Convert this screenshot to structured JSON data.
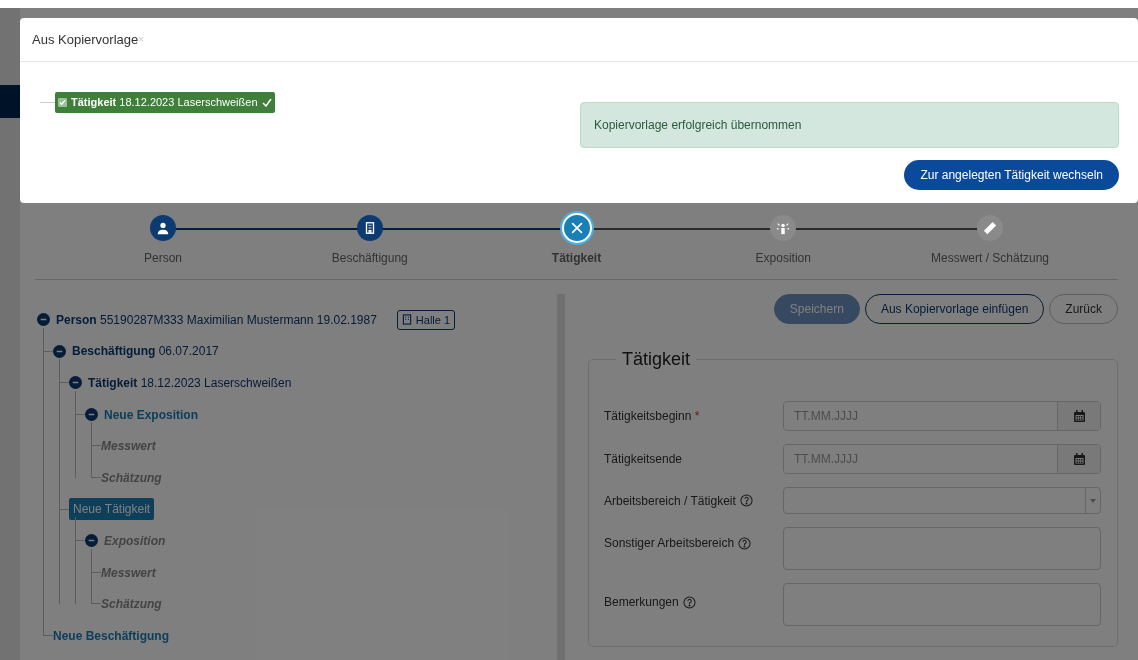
{
  "modal": {
    "title": "Aus Kopiervorlage",
    "close": "×",
    "template_item": {
      "label": "Tätigkeit",
      "detail": "18.12.2023 Laserschweißen",
      "checked": true,
      "confirmed": true
    },
    "alert": "Kopiervorlage erfolgreich übernommen",
    "button": "Zur angelegten Tätigkeit wechseln"
  },
  "stepper": [
    {
      "label": "Person",
      "completed": true,
      "selected": false
    },
    {
      "label": "Beschäftigung",
      "completed": true,
      "selected": false
    },
    {
      "label": "Tätigkeit",
      "completed": false,
      "selected": true
    },
    {
      "label": "Exposition",
      "completed": false,
      "selected": false
    },
    {
      "label": "Messwert / Schätzung",
      "completed": false,
      "selected": false
    }
  ],
  "tree": [
    {
      "label": "Person",
      "detail": "55190287M333 Maximilian Mustermann 19.02.1987",
      "badge": "Halle 1",
      "kind": "record",
      "expanded": true,
      "selected": false,
      "children": [
        {
          "label": "Beschäftigung",
          "detail": "06.07.2017",
          "kind": "record",
          "expanded": true,
          "selected": false,
          "children": [
            {
              "label": "Tätigkeit",
              "detail": "18.12.2023 Laserschweißen",
              "kind": "record",
              "expanded": true,
              "selected": false,
              "children": [
                {
                  "label": "Neue Exposition",
                  "kind": "new",
                  "expanded": true,
                  "selected": false,
                  "children": [
                    {
                      "label": "Messwert",
                      "kind": "placeholder",
                      "selected": false
                    },
                    {
                      "label": "Schätzung",
                      "kind": "placeholder",
                      "selected": false
                    }
                  ]
                }
              ]
            },
            {
              "label": "Neue Tätigkeit",
              "kind": "new",
              "selected": true,
              "children": [
                {
                  "label": "Exposition",
                  "kind": "placeholder",
                  "expanded": true,
                  "selected": false,
                  "children": [
                    {
                      "label": "Messwert",
                      "kind": "placeholder",
                      "selected": false
                    },
                    {
                      "label": "Schätzung",
                      "kind": "placeholder",
                      "selected": false
                    }
                  ]
                }
              ]
            }
          ]
        },
        {
          "label": "Neue Beschäftigung",
          "kind": "new",
          "selected": false
        }
      ]
    }
  ],
  "actions": [
    {
      "label": "Speichern",
      "kind": "primary",
      "disabled": true
    },
    {
      "label": "Aus Kopiervorlage einfügen",
      "kind": "outline",
      "disabled": false
    },
    {
      "label": "Zurück",
      "kind": "default",
      "disabled": false
    }
  ],
  "form": {
    "legend": "Tätigkeit",
    "required_mark": "*",
    "fields": [
      {
        "label": "Tätigkeitsbeginn",
        "kind": "date",
        "placeholder": "TT.MM.JJJJ",
        "required": true,
        "help": false
      },
      {
        "label": "Tätigkeitsende",
        "kind": "date",
        "placeholder": "TT.MM.JJJJ",
        "required": false,
        "help": false
      },
      {
        "label": "Arbeitsbereich / Tätigkeit",
        "kind": "select",
        "required": false,
        "help": true
      },
      {
        "label": "Sonstiger Arbeitsbereich",
        "kind": "textarea",
        "required": false,
        "help": true
      },
      {
        "label": "Bemerkungen",
        "kind": "textarea",
        "required": false,
        "help": true
      }
    ]
  }
}
